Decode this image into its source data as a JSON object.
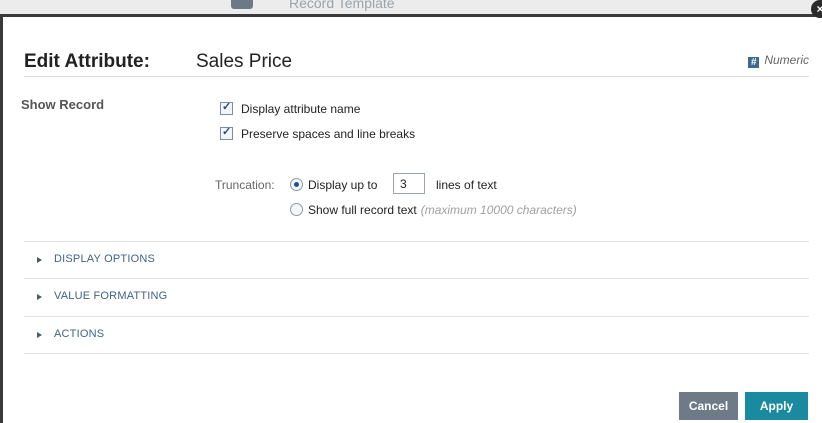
{
  "background": {
    "label": "Record Template"
  },
  "dialog": {
    "title_prefix": "Edit Attribute:",
    "attribute_name": "Sales Price",
    "type_icon": "#",
    "type_label": "Numeric",
    "close_glyph": "×"
  },
  "show_record": {
    "section_label": "Show Record",
    "options": [
      {
        "label": "Display attribute name",
        "checked": true
      },
      {
        "label": "Preserve spaces and line breaks",
        "checked": true
      }
    ],
    "truncation": {
      "label": "Truncation:",
      "display_up_to_label": "Display up to",
      "lines_value": "3",
      "lines_suffix": "lines of text",
      "show_full_label": "Show  full record text",
      "show_full_hint": "(maximum 10000 characters)",
      "selected": "display_up_to"
    }
  },
  "sections": [
    {
      "label": "DISPLAY OPTIONS"
    },
    {
      "label": "VALUE FORMATTING"
    },
    {
      "label": "ACTIONS"
    }
  ],
  "footer": {
    "cancel_label": "Cancel",
    "apply_label": "Apply"
  },
  "colors": {
    "accent": "#1a8aa0",
    "section_link": "#3f6385",
    "cancel_button": "#6e7b87"
  }
}
